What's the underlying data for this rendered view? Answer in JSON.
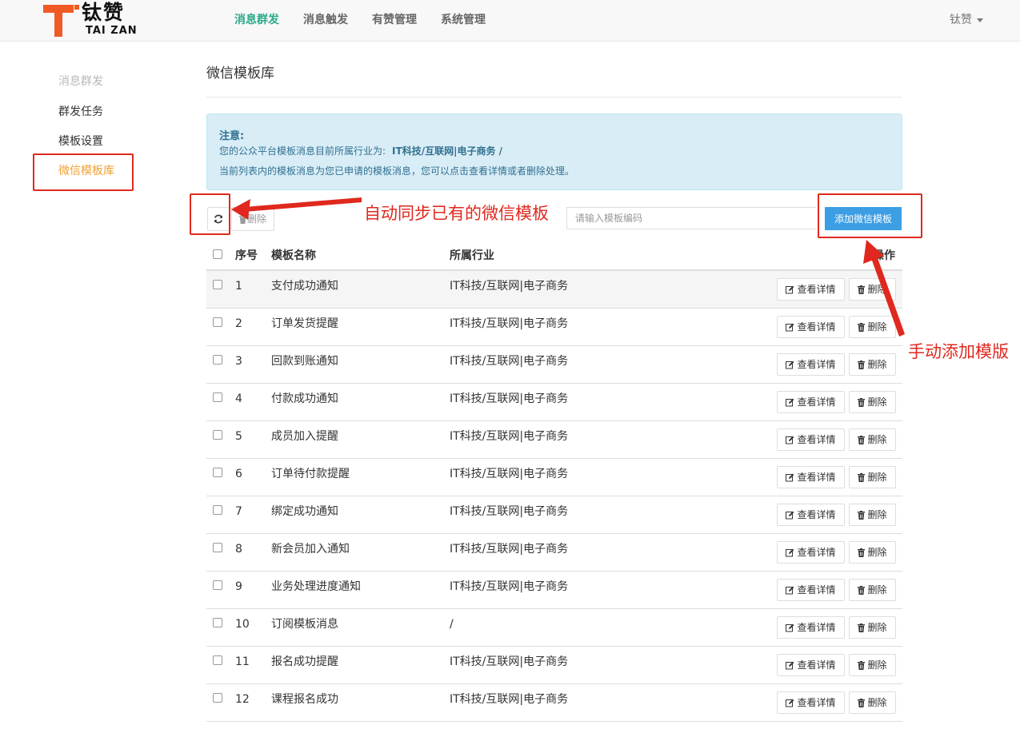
{
  "header": {
    "logo_cn": "钛赞",
    "logo_en": "TAI ZAN",
    "nav": [
      {
        "label": "消息群发",
        "active": true
      },
      {
        "label": "消息触发",
        "active": false
      },
      {
        "label": "有赞管理",
        "active": false
      },
      {
        "label": "系统管理",
        "active": false
      }
    ],
    "user": "钛赞"
  },
  "sidebar": {
    "heading": "消息群发",
    "items": [
      {
        "label": "群发任务",
        "active": false
      },
      {
        "label": "模板设置",
        "active": false
      },
      {
        "label": "微信模板库",
        "active": true
      }
    ]
  },
  "main": {
    "title": "微信模板库",
    "notice": {
      "title": "注意:",
      "line1_prefix": "您的公众平台模板消息目前所属行业为:",
      "line1_value": "IT科技/互联网|电子商务   /",
      "line2": "当前列表内的模板消息为您已申请的模板消息，您可以点击查看详情或者删除处理。"
    },
    "toolbar": {
      "delete_label": "删除",
      "search_placeholder": "请输入模板编码",
      "add_label": "添加微信模板"
    },
    "table": {
      "headers": {
        "no": "序号",
        "name": "模板名称",
        "industry": "所属行业",
        "op": "操作"
      },
      "view_label": "查看详情",
      "delete_label": "删除",
      "rows": [
        {
          "no": "1",
          "name": "支付成功通知",
          "industry": "IT科技/互联网|电子商务"
        },
        {
          "no": "2",
          "name": "订单发货提醒",
          "industry": "IT科技/互联网|电子商务"
        },
        {
          "no": "3",
          "name": "回款到账通知",
          "industry": "IT科技/互联网|电子商务"
        },
        {
          "no": "4",
          "name": "付款成功通知",
          "industry": "IT科技/互联网|电子商务"
        },
        {
          "no": "5",
          "name": "成员加入提醒",
          "industry": "IT科技/互联网|电子商务"
        },
        {
          "no": "6",
          "name": "订单待付款提醒",
          "industry": "IT科技/互联网|电子商务"
        },
        {
          "no": "7",
          "name": "绑定成功通知",
          "industry": "IT科技/互联网|电子商务"
        },
        {
          "no": "8",
          "name": "新会员加入通知",
          "industry": "IT科技/互联网|电子商务"
        },
        {
          "no": "9",
          "name": "业务处理进度通知",
          "industry": "IT科技/互联网|电子商务"
        },
        {
          "no": "10",
          "name": "订阅模板消息",
          "industry": "/"
        },
        {
          "no": "11",
          "name": "报名成功提醒",
          "industry": "IT科技/互联网|电子商务"
        },
        {
          "no": "12",
          "name": "课程报名成功",
          "industry": "IT科技/互联网|电子商务"
        }
      ]
    }
  },
  "annotations": {
    "sync": "自动同步已有的微信模板",
    "manual": "手动添加模版"
  },
  "colors": {
    "nav_active": "#2aaa8a",
    "sidebar_active": "#f0a030",
    "primary_button": "#3c9ee5",
    "notice_bg": "#d9edf7",
    "notice_text": "#31708f",
    "annotation_red": "#e0281e",
    "logo_orange": "#f05a24"
  }
}
